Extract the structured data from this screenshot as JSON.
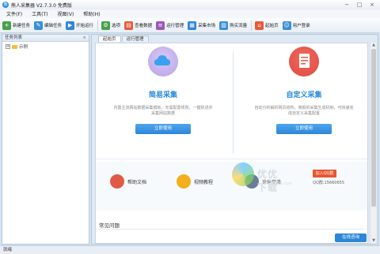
{
  "window": {
    "title": "熊人采集器 V2.7.3.0 免费版",
    "logo": "熊",
    "controls": [
      "−",
      "□",
      "×"
    ]
  },
  "menu": [
    "文件(F)",
    "工具(T)",
    "视图(V)",
    "帮助(H)"
  ],
  "toolbar": [
    {
      "label": "新建任务",
      "icon": "new-task-icon",
      "glyph": "+",
      "color": "#4aa04a"
    },
    {
      "label": "编辑任务",
      "icon": "edit-task-icon",
      "glyph": "✎",
      "color": "#3a8fd8"
    },
    {
      "label": "开始运行",
      "icon": "start-run-icon",
      "glyph": "▶",
      "color": "#2f86d8"
    },
    {
      "label": "选项",
      "icon": "options-icon",
      "glyph": "⚙",
      "color": "#4aa04a"
    },
    {
      "label": "查看数据",
      "icon": "view-data-icon",
      "glyph": "▤",
      "color": "#e85a3a"
    },
    {
      "label": "运行管理",
      "icon": "run-manage-icon",
      "glyph": "≡",
      "color": "#9b59b6"
    },
    {
      "label": "采集市场",
      "icon": "market-icon",
      "glyph": "▦",
      "color": "#2f86d8"
    },
    {
      "label": "购买流量",
      "icon": "buy-traffic-icon",
      "glyph": "▥",
      "color": "#3a8fd8"
    },
    {
      "label": "起始页",
      "icon": "home-icon",
      "glyph": "⌂",
      "color": "#e85a3a"
    },
    {
      "label": "用户登录",
      "icon": "user-login-icon",
      "glyph": "☺",
      "color": "#3a8fd8"
    }
  ],
  "left_panel": {
    "title": "任务列表",
    "close": "×",
    "tree": [
      {
        "expander": "+",
        "label": "示例"
      }
    ]
  },
  "tabs": [
    "起始页",
    "运行管理"
  ],
  "cards": {
    "simple": {
      "title": "简易采集",
      "desc": "内置主流网站数据采集模板，无需配置规则，一键抓进并采集网站数据",
      "button": "立即使用",
      "color": "#c9b6ef"
    },
    "custom": {
      "title": "自定义采集",
      "desc": "自动分析解析网页结构，简报的采集生成机制，可快速完成自定义采集配置",
      "button": "立即使用",
      "color": "#e8534a"
    }
  },
  "links": [
    {
      "label": "帮助文档",
      "icon": "help-doc-icon",
      "color": "#e05a45"
    },
    {
      "label": "视频教程",
      "icon": "video-tutorial-icon",
      "color": "#f2b01e"
    },
    {
      "label": "论坛交流",
      "icon": "forum-icon",
      "color": "#6a7d99"
    }
  ],
  "qq": {
    "badge": "加入QQ群",
    "number": "QQ群:15660655"
  },
  "faq": {
    "title": "常见问题"
  },
  "watermark": {
    "text": "优优下载",
    "url": "www.yyxt.com"
  },
  "help_button": "在线咨询",
  "status": "就绪"
}
